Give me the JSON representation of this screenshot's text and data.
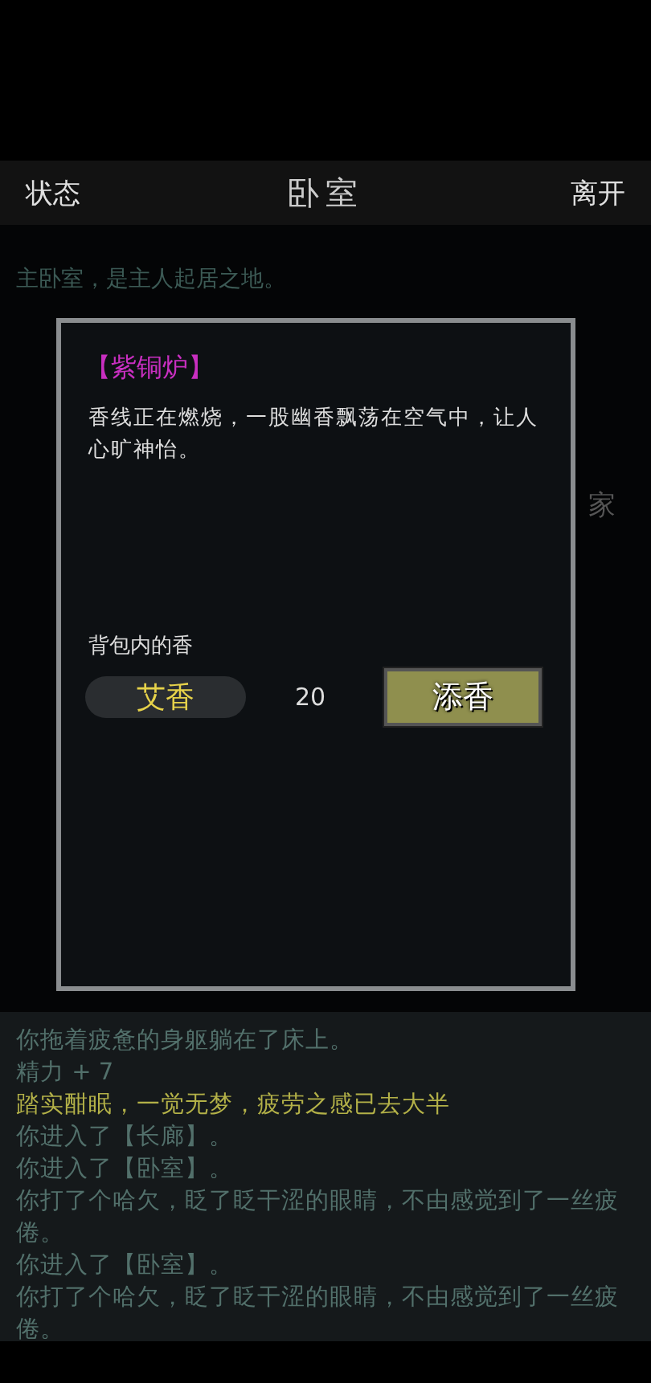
{
  "header": {
    "left": "状态",
    "title": "卧室",
    "right": "离开"
  },
  "room": {
    "description": "主卧室，是主人起居之地。",
    "partial_label": "家"
  },
  "dialog": {
    "title": "【紫铜炉】",
    "description": "香线正在燃烧，一股幽香飘荡在空气中，让人心旷神怡。",
    "section_label": "背包内的香",
    "items": [
      {
        "name": "艾香",
        "count": "20",
        "action": "添香"
      }
    ]
  },
  "log": [
    {
      "kind": "normal",
      "text": "你拖着疲惫的身躯躺在了床上。"
    },
    {
      "kind": "normal",
      "text": "精力 + 7"
    },
    {
      "kind": "highlight",
      "text": "踏实酣眠，一觉无梦，疲劳之感已去大半"
    },
    {
      "kind": "normal",
      "text": "你进入了【长廊】。"
    },
    {
      "kind": "normal",
      "text": "你进入了【卧室】。"
    },
    {
      "kind": "normal",
      "text": "你打了个哈欠，眨了眨干涩的眼睛，不由感觉到了一丝疲倦。"
    },
    {
      "kind": "normal",
      "text": "你进入了【卧室】。"
    },
    {
      "kind": "normal",
      "text": "你打了个哈欠，眨了眨干涩的眼睛，不由感觉到了一丝疲倦。"
    }
  ]
}
